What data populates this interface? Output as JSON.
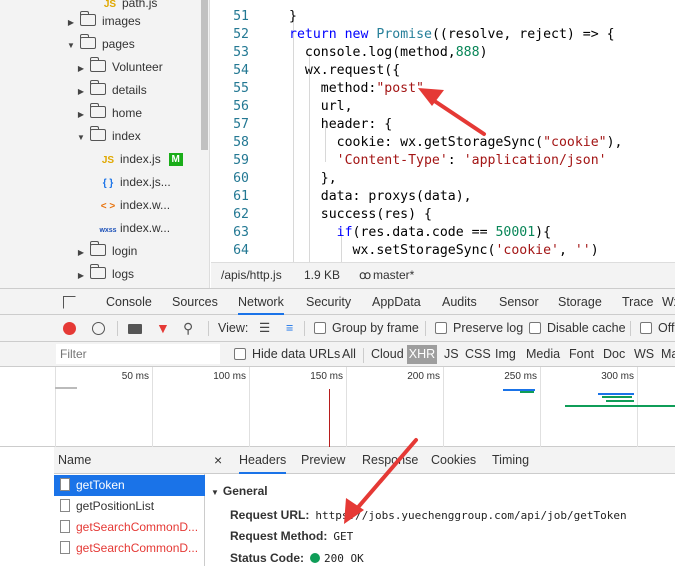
{
  "tree": {
    "items": [
      {
        "label": "path.js",
        "kind": "js",
        "icon": "JS"
      },
      {
        "label": "images",
        "kind": "folder",
        "expanded": false
      },
      {
        "label": "pages",
        "kind": "folder",
        "expanded": true
      },
      {
        "label": "Volunteer",
        "kind": "folder",
        "expanded": false
      },
      {
        "label": "details",
        "kind": "folder",
        "expanded": false
      },
      {
        "label": "home",
        "kind": "folder",
        "expanded": false
      },
      {
        "label": "index",
        "kind": "folder",
        "expanded": true
      },
      {
        "label": "index.js",
        "kind": "js",
        "icon": "JS",
        "badge": "M"
      },
      {
        "label": "index.js...",
        "kind": "json",
        "icon": "{ }"
      },
      {
        "label": "index.w...",
        "kind": "wxml",
        "icon": "< >"
      },
      {
        "label": "index.w...",
        "kind": "wxss",
        "icon": "wxss"
      },
      {
        "label": "login",
        "kind": "folder",
        "expanded": false
      },
      {
        "label": "logs",
        "kind": "folder",
        "expanded": false
      }
    ]
  },
  "editor": {
    "lines": [
      {
        "n": "51",
        "code": "}"
      },
      {
        "n": "52",
        "code": "return new Promise((resolve, reject) => {"
      },
      {
        "n": "53",
        "code": "  console.log(method,888)"
      },
      {
        "n": "54",
        "code": "  wx.request({"
      },
      {
        "n": "55",
        "code": "    method:\"post\","
      },
      {
        "n": "56",
        "code": "    url,"
      },
      {
        "n": "57",
        "code": "    header: {"
      },
      {
        "n": "58",
        "code": "      cookie: wx.getStorageSync(\"cookie\"),"
      },
      {
        "n": "59",
        "code": "      'Content-Type': 'application/json'"
      },
      {
        "n": "60",
        "code": "    },"
      },
      {
        "n": "61",
        "code": "    data: proxys(data),"
      },
      {
        "n": "62",
        "code": "    success(res) {"
      },
      {
        "n": "63",
        "code": "      if(res.data.code == 50001){"
      },
      {
        "n": "64",
        "code": "        wx.setStorageSync('cookie', '')"
      }
    ]
  },
  "statusbar": {
    "path": "/apis/http.js",
    "size": "1.9 KB",
    "branch": "master*"
  },
  "devtools": {
    "tabs": [
      "Console",
      "Sources",
      "Network",
      "Security",
      "AppData",
      "Audits",
      "Sensor",
      "Storage",
      "Trace",
      "Wx"
    ],
    "active_tab": "Network"
  },
  "net_toolbar": {
    "view_label": "View:",
    "group_by_frame": "Group by frame",
    "preserve_log": "Preserve log",
    "disable_cache": "Disable cache",
    "offline": "Off"
  },
  "filter_bar": {
    "placeholder": "Filter",
    "hide_data_urls": "Hide data URLs",
    "types": [
      "All",
      "Cloud",
      "XHR",
      "JS",
      "CSS",
      "Img",
      "Media",
      "Font",
      "Doc",
      "WS",
      "Ma"
    ],
    "active_type": "XHR"
  },
  "timeline": {
    "ticks": [
      "50 ms",
      "100 ms",
      "150 ms",
      "200 ms",
      "250 ms",
      "300 ms"
    ],
    "colors": {
      "wait": "#1a73e8",
      "receive": "#0f9d58",
      "marker": "#b71c1c"
    }
  },
  "requests": {
    "header": "Name",
    "items": [
      {
        "name": "getToken",
        "selected": true,
        "error": false
      },
      {
        "name": "getPositionList",
        "selected": false,
        "error": false
      },
      {
        "name": "getSearchCommonD...",
        "selected": false,
        "error": true
      },
      {
        "name": "getSearchCommonD...",
        "selected": false,
        "error": true
      }
    ]
  },
  "details": {
    "close": "×",
    "tabs": [
      "Headers",
      "Preview",
      "Response",
      "Cookies",
      "Timing"
    ],
    "active_tab": "Headers",
    "section_title": "General",
    "request_url_key": "Request URL:",
    "request_url": "https://jobs.yuechenggroup.com/api/job/getToken",
    "request_method_key": "Request Method:",
    "request_method": "GET",
    "status_code_key": "Status Code:",
    "status_code": "200 OK",
    "status_color": "#0f9d58"
  },
  "colors": {
    "annotation_arrow": "#e53935",
    "accent": "#1a73e8"
  }
}
